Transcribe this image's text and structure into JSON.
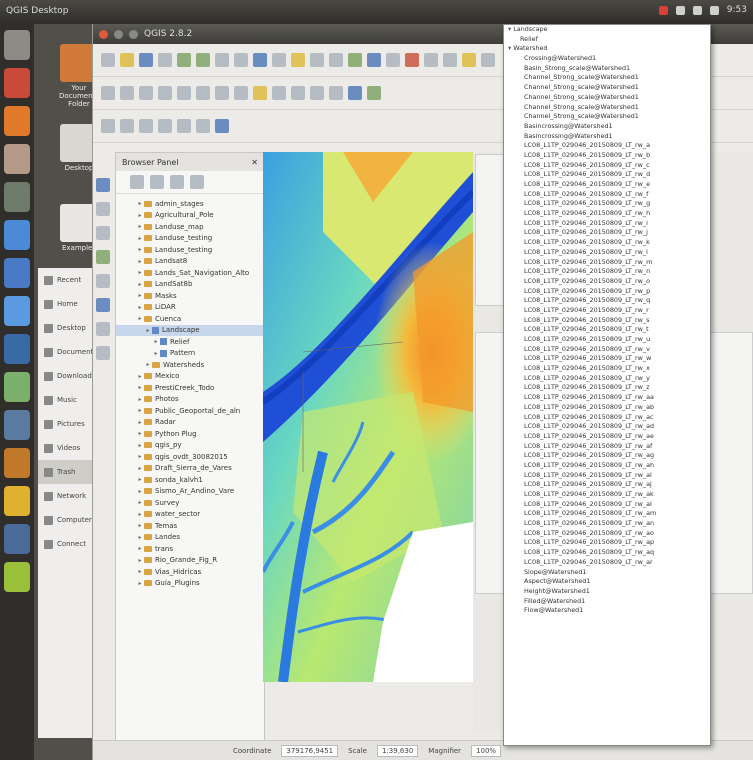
{
  "system": {
    "title": "QGIS Desktop",
    "tray_text": "9:53"
  },
  "qgis": {
    "window_title": "QGIS 2.8.2",
    "browser": {
      "title": "Browser Panel",
      "items": [
        {
          "label": "admin_stages",
          "depth": 0,
          "type": "folder"
        },
        {
          "label": "Agricultural_Pole",
          "depth": 0,
          "type": "folder"
        },
        {
          "label": "Landuse_map",
          "depth": 0,
          "type": "folder"
        },
        {
          "label": "Landuse_testing",
          "depth": 0,
          "type": "folder"
        },
        {
          "label": "Landuse_testing",
          "depth": 0,
          "type": "folder"
        },
        {
          "label": "Landsat8",
          "depth": 0,
          "type": "folder"
        },
        {
          "label": "Lands_Sat_Navigation_Alto",
          "depth": 0,
          "type": "folder"
        },
        {
          "label": "LandSat8b",
          "depth": 0,
          "type": "folder"
        },
        {
          "label": "Masks",
          "depth": 0,
          "type": "folder"
        },
        {
          "label": "LiDAR",
          "depth": 0,
          "type": "folder"
        },
        {
          "label": "Cuenca",
          "depth": 0,
          "type": "folder"
        },
        {
          "label": "Landscape",
          "depth": 1,
          "type": "layer",
          "selected": true
        },
        {
          "label": "Relief",
          "depth": 2,
          "type": "layer"
        },
        {
          "label": "Pattern",
          "depth": 2,
          "type": "layer"
        },
        {
          "label": "Watersheds",
          "depth": 1,
          "type": "folder"
        },
        {
          "label": "Mexico",
          "depth": 0,
          "type": "folder"
        },
        {
          "label": "PrestiCreek_Todo",
          "depth": 0,
          "type": "folder"
        },
        {
          "label": "Photos",
          "depth": 0,
          "type": "folder"
        },
        {
          "label": "Public_Geoportal_de_aln",
          "depth": 0,
          "type": "folder"
        },
        {
          "label": "Radar",
          "depth": 0,
          "type": "folder"
        },
        {
          "label": "Python Plug",
          "depth": 0,
          "type": "folder"
        },
        {
          "label": "qgis_py",
          "depth": 0,
          "type": "folder"
        },
        {
          "label": "qgis_ovdt_30082015",
          "depth": 0,
          "type": "folder"
        },
        {
          "label": "Draft_Sierra_de_Vares",
          "depth": 0,
          "type": "folder"
        },
        {
          "label": "sonda_kalvh1",
          "depth": 0,
          "type": "folder"
        },
        {
          "label": "Sismo_Ar_Andino_Vare",
          "depth": 0,
          "type": "folder"
        },
        {
          "label": "Survey",
          "depth": 0,
          "type": "folder"
        },
        {
          "label": "water_sector",
          "depth": 0,
          "type": "folder"
        },
        {
          "label": "Temas",
          "depth": 0,
          "type": "folder"
        },
        {
          "label": "Landes",
          "depth": 0,
          "type": "folder"
        },
        {
          "label": "trans",
          "depth": 0,
          "type": "folder"
        },
        {
          "label": "Rio_Grande_Fig_R",
          "depth": 0,
          "type": "folder"
        },
        {
          "label": "Vias_Hidricas",
          "depth": 0,
          "type": "folder"
        },
        {
          "label": "Guia_Plugins",
          "depth": 0,
          "type": "folder"
        }
      ]
    },
    "status": {
      "coord_label": "Coordinate",
      "coord_value": "379176,9451",
      "scale_label": "Scale",
      "scale_value": "1:39,630",
      "magnifier_label": "Magnifier",
      "magnifier_value": "100%"
    }
  },
  "desktop": {
    "files": [
      {
        "label": "Your Documents Folder"
      },
      {
        "label": "Desktop"
      },
      {
        "label": "Examples"
      }
    ],
    "filemgr_items": [
      "Recent",
      "Home",
      "Desktop",
      "Documents",
      "Downloads",
      "Music",
      "Pictures",
      "Videos",
      "Trash",
      "Network",
      "Computer",
      "Connect"
    ]
  },
  "dropdown": {
    "items": [
      {
        "label": "Landscape",
        "depth": 0,
        "arrow": "▾"
      },
      {
        "label": "Relief",
        "depth": 1
      },
      {
        "label": "Watershed",
        "depth": 0,
        "arrow": "▾"
      },
      {
        "label": "Crossing@Watershed1",
        "depth": 2
      },
      {
        "label": "Basin_Strong_scale@Watershed1",
        "depth": 2
      },
      {
        "label": "Channel_Strong_scale@Watershed1",
        "depth": 2
      },
      {
        "label": "Channel_Strong_scale@Watershed1",
        "depth": 2
      },
      {
        "label": "Channel_Strong_scale@Watershed1",
        "depth": 2
      },
      {
        "label": "Channel_Strong_scale@Watershed1",
        "depth": 2
      },
      {
        "label": "Channel_Strong_scale@Watershed1",
        "depth": 2
      },
      {
        "label": "Basincrossing@Watershed1",
        "depth": 2
      },
      {
        "label": "Basincrossing@Watershed1",
        "depth": 2
      },
      {
        "label": "LC08_L1TP_029046_20150809_LT_rw_a",
        "depth": 2
      },
      {
        "label": "LC08_L1TP_029046_20150809_LT_rw_b",
        "depth": 2
      },
      {
        "label": "LC08_L1TP_029046_20150809_LT_rw_c",
        "depth": 2
      },
      {
        "label": "LC08_L1TP_029046_20150809_LT_rw_d",
        "depth": 2
      },
      {
        "label": "LC08_L1TP_029046_20150809_LT_rw_e",
        "depth": 2
      },
      {
        "label": "LC08_L1TP_029046_20150809_LT_rw_f",
        "depth": 2
      },
      {
        "label": "LC08_L1TP_029046_20150809_LT_rw_g",
        "depth": 2
      },
      {
        "label": "LC08_L1TP_029046_20150809_LT_rw_h",
        "depth": 2
      },
      {
        "label": "LC08_L1TP_029046_20150809_LT_rw_i",
        "depth": 2
      },
      {
        "label": "LC08_L1TP_029046_20150809_LT_rw_j",
        "depth": 2
      },
      {
        "label": "LC08_L1TP_029046_20150809_LT_rw_k",
        "depth": 2
      },
      {
        "label": "LC08_L1TP_029046_20150809_LT_rw_l",
        "depth": 2
      },
      {
        "label": "LC08_L1TP_029046_20150809_LT_rw_m",
        "depth": 2
      },
      {
        "label": "LC08_L1TP_029046_20150809_LT_rw_n",
        "depth": 2
      },
      {
        "label": "LC08_L1TP_029046_20150809_LT_rw_o",
        "depth": 2
      },
      {
        "label": "LC08_L1TP_029046_20150809_LT_rw_p",
        "depth": 2
      },
      {
        "label": "LC08_L1TP_029046_20150809_LT_rw_q",
        "depth": 2
      },
      {
        "label": "LC08_L1TP_029046_20150809_LT_rw_r",
        "depth": 2
      },
      {
        "label": "LC08_L1TP_029046_20150809_LT_rw_s",
        "depth": 2
      },
      {
        "label": "LC08_L1TP_029046_20150809_LT_rw_t",
        "depth": 2
      },
      {
        "label": "LC08_L1TP_029046_20150809_LT_rw_u",
        "depth": 2
      },
      {
        "label": "LC08_L1TP_029046_20150809_LT_rw_v",
        "depth": 2
      },
      {
        "label": "LC08_L1TP_029046_20150809_LT_rw_w",
        "depth": 2
      },
      {
        "label": "LC08_L1TP_029046_20150809_LT_rw_x",
        "depth": 2
      },
      {
        "label": "LC08_L1TP_029046_20150809_LT_rw_y",
        "depth": 2
      },
      {
        "label": "LC08_L1TP_029046_20150809_LT_rw_z",
        "depth": 2
      },
      {
        "label": "LC08_L1TP_029046_20150809_LT_rw_aa",
        "depth": 2
      },
      {
        "label": "LC08_L1TP_029046_20150809_LT_rw_ab",
        "depth": 2
      },
      {
        "label": "LC08_L1TP_029046_20150809_LT_rw_ac",
        "depth": 2
      },
      {
        "label": "LC08_L1TP_029046_20150809_LT_rw_ad",
        "depth": 2
      },
      {
        "label": "LC08_L1TP_029046_20150809_LT_rw_ae",
        "depth": 2
      },
      {
        "label": "LC08_L1TP_029046_20150809_LT_rw_af",
        "depth": 2
      },
      {
        "label": "LC08_L1TP_029046_20150809_LT_rw_ag",
        "depth": 2
      },
      {
        "label": "LC08_L1TP_029046_20150809_LT_rw_ah",
        "depth": 2
      },
      {
        "label": "LC08_L1TP_029046_20150809_LT_rw_ai",
        "depth": 2
      },
      {
        "label": "LC08_L1TP_029046_20150809_LT_rw_aj",
        "depth": 2
      },
      {
        "label": "LC08_L1TP_029046_20150809_LT_rw_ak",
        "depth": 2
      },
      {
        "label": "LC08_L1TP_029046_20150809_LT_rw_al",
        "depth": 2
      },
      {
        "label": "LC08_L1TP_029046_20150809_LT_rw_am",
        "depth": 2
      },
      {
        "label": "LC08_L1TP_029046_20150809_LT_rw_an",
        "depth": 2
      },
      {
        "label": "LC08_L1TP_029046_20150809_LT_rw_ao",
        "depth": 2
      },
      {
        "label": "LC08_L1TP_029046_20150809_LT_rw_ap",
        "depth": 2
      },
      {
        "label": "LC08_L1TP_029046_20150809_LT_rw_aq",
        "depth": 2
      },
      {
        "label": "LC08_L1TP_029046_20150809_LT_rw_ar",
        "depth": 2
      },
      {
        "label": "Slope@Watershed1",
        "depth": 2
      },
      {
        "label": "Aspect@Watershed1",
        "depth": 2
      },
      {
        "label": "Height@Watershed1",
        "depth": 2
      },
      {
        "label": "Filled@Watershed1",
        "depth": 2
      },
      {
        "label": "Flow@Watershed1",
        "depth": 2
      }
    ]
  },
  "colors": {
    "dem_low": "#1f4fd6",
    "dem_mid": "#5cd0c8",
    "dem_high": "#f39a2a"
  }
}
